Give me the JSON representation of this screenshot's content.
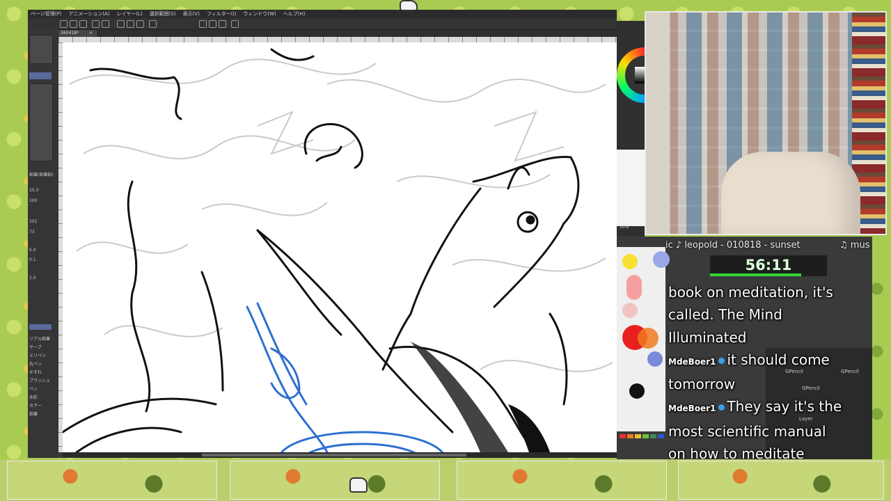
{
  "menu": {
    "items": [
      "ページ管理(P)",
      "アニメーション(A)",
      "レイヤー(L)",
      "選択範囲(S)",
      "表示(V)",
      "フィルター(I)",
      "ウィンドウ(W)",
      "ヘルプ(H)"
    ]
  },
  "doc_tab": {
    "label": "260418*",
    "close": "×"
  },
  "left_panel": {
    "brush_label": "鉛筆(鉛筆鉛)",
    "values": [
      "15.3",
      "100",
      "101",
      "73",
      "5.0",
      "0.1",
      "1.0"
    ],
    "subtools": [
      "リアル鉛筆",
      "サーブ",
      "ミリペン",
      "丸ペン",
      "かすれ",
      "ブラッシュ",
      "ペン",
      "水彩",
      "カラー",
      "鉛筆"
    ]
  },
  "right_panel": {
    "zoom": "30.6"
  },
  "now_playing": {
    "left": "ic ♪ leopold - 010818 - sunset",
    "right": "♫ mus"
  },
  "timer": {
    "value": "56:11",
    "progress": 0.78
  },
  "chat": {
    "line1": "book on meditation, it's",
    "line2": "called. The Mind",
    "line3": "Illuminated",
    "msg1_user": "MdeBoer1",
    "msg1_a": "it should come",
    "msg1_b": "tomorrow",
    "msg2_user": "MdeBoer1",
    "msg2_a": "They say it's the",
    "msg2_b": "most scientific manual",
    "msg2_c": "on how to meditate"
  },
  "blender_panel": {
    "items": [
      "GPencil",
      "GPencil",
      "GPencil",
      "Layer"
    ]
  },
  "palette_swatches": [
    "#f7e030",
    "#f5a0a0",
    "#9aa8e8",
    "#f3c3c3",
    "#e85a3a",
    "#f07a20",
    "#3a8a5a",
    "#7a8ad8",
    "#111111"
  ],
  "colors": {
    "accent": "#34d834",
    "bg": "#a9cb52",
    "window": "#3b3b3b"
  }
}
